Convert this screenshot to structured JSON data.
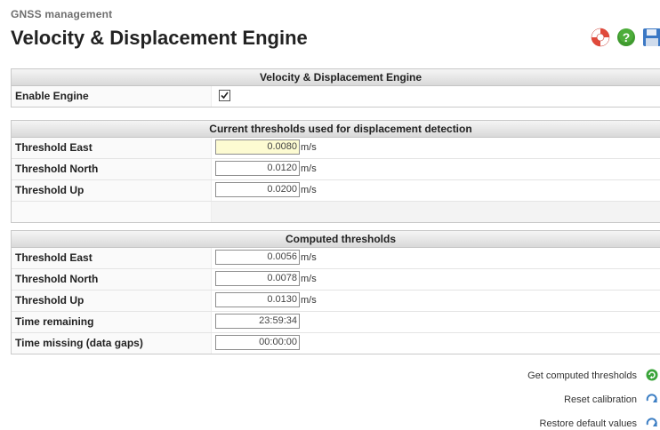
{
  "header": {
    "breadcrumb": "GNSS management",
    "title": "Velocity & Displacement Engine"
  },
  "toolbar": {
    "icons": [
      "help-lifebuoy-icon",
      "help-question-icon",
      "save-disk-icon"
    ]
  },
  "engine_panel": {
    "heading": "Velocity & Displacement Engine",
    "enable_label": "Enable Engine",
    "enable_checked": true
  },
  "current_panel": {
    "heading": "Current thresholds used for displacement detection",
    "rows": [
      {
        "label": "Threshold East",
        "value": "0.0080",
        "unit": "m/s"
      },
      {
        "label": "Threshold North",
        "value": "0.0120",
        "unit": "m/s"
      },
      {
        "label": "Threshold Up",
        "value": "0.0200",
        "unit": "m/s"
      }
    ]
  },
  "computed_panel": {
    "heading": "Computed thresholds",
    "rows": [
      {
        "label": "Threshold East",
        "value": "0.0056",
        "unit": "m/s"
      },
      {
        "label": "Threshold North",
        "value": "0.0078",
        "unit": "m/s"
      },
      {
        "label": "Threshold Up",
        "value": "0.0130",
        "unit": "m/s"
      },
      {
        "label": "Time remaining",
        "value": "23:59:34",
        "unit": ""
      },
      {
        "label": "Time missing (data gaps)",
        "value": "00:00:00",
        "unit": ""
      }
    ]
  },
  "actions": [
    {
      "label": "Get computed thresholds",
      "icon": "refresh-green-icon",
      "color": "#3aa43a"
    },
    {
      "label": "Reset calibration",
      "icon": "reset-blue-icon",
      "color": "#3d7fc4"
    },
    {
      "label": "Restore default values",
      "icon": "restore-blue-icon",
      "color": "#3d7fc4"
    }
  ]
}
